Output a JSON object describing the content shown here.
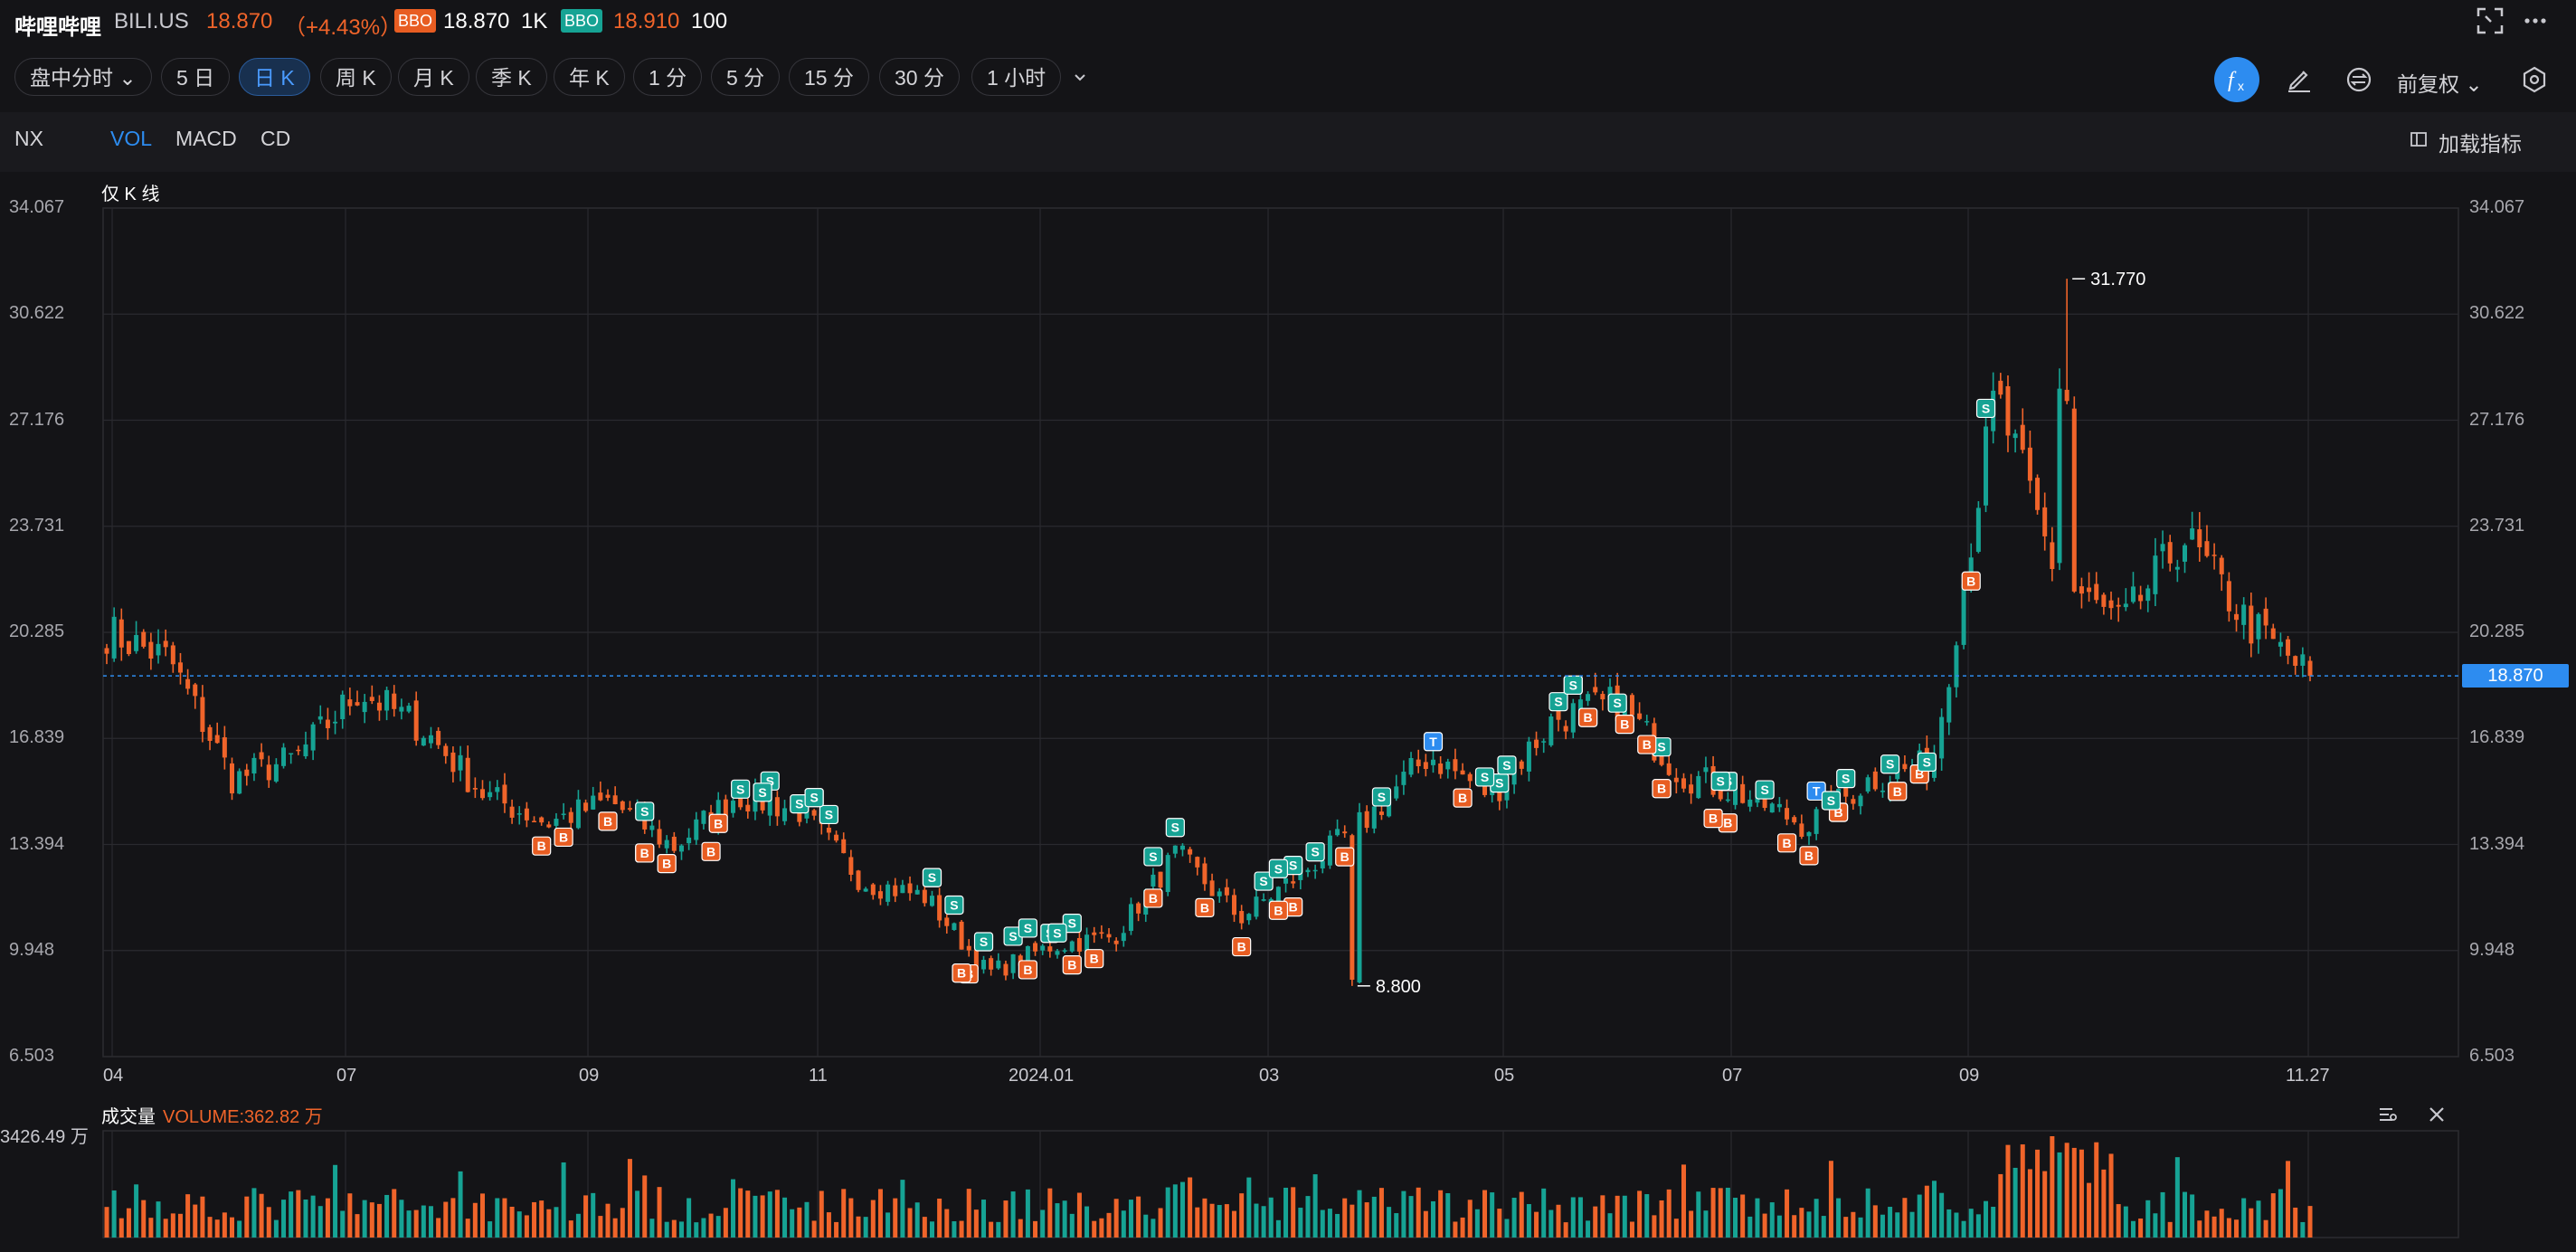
{
  "header": {
    "name": "哔哩哔哩",
    "ticker": "BILI.US",
    "price": "18.870",
    "change": "（+4.43%）",
    "bbo_bid_badge": "BBO",
    "bbo_bid_price": "18.870",
    "bbo_bid_qty": "1K",
    "bbo_ask_badge": "BBO",
    "bbo_ask_price": "18.910",
    "bbo_ask_qty": "100",
    "icons": [
      "fullscreen-icon",
      "more-icon"
    ]
  },
  "periods": {
    "items": [
      "盘中分时",
      "5 日",
      "日 K",
      "周 K",
      "月 K",
      "季 K",
      "年 K",
      "1 分",
      "5 分",
      "15 分",
      "30 分",
      "1 小时"
    ],
    "active": "日 K"
  },
  "right_toolbar": {
    "adjust": "前复权",
    "icons": [
      "formula-icon",
      "draw-icon",
      "compare-icon",
      "settings-icon"
    ]
  },
  "indicators": {
    "main": "NX",
    "items": [
      "VOL",
      "MACD",
      "CD"
    ],
    "active": "VOL",
    "load": "加载指标"
  },
  "chart": {
    "main_label": "仅 K 线",
    "price_ticks": [
      "34.067",
      "30.622",
      "27.176",
      "23.731",
      "20.285",
      "16.839",
      "13.394",
      "9.948",
      "6.503"
    ],
    "date_ticks": [
      "04",
      "07",
      "09",
      "11",
      "2024.01",
      "03",
      "05",
      "07",
      "09",
      "11.27"
    ],
    "current_price": "18.870",
    "high_label": "31.770",
    "low_label": "8.800",
    "colors": {
      "up": "#16a394",
      "down": "#f0642a",
      "current": "#2d8cf0"
    }
  },
  "volume": {
    "title": "成交量",
    "value": "VOLUME:362.82 万",
    "max": "3426.49 万"
  },
  "chart_data": {
    "type": "candlestick",
    "title": "仅 K 线",
    "ylim": [
      6.503,
      34.067
    ],
    "current_price": 18.87,
    "high": 31.77,
    "low": 8.8,
    "x_ticks": [
      "04",
      "07",
      "09",
      "11",
      "2024.01",
      "03",
      "05",
      "07",
      "09",
      "11.27"
    ],
    "close_path": [
      [
        "04",
        20.3
      ],
      [
        "05",
        19.4
      ],
      [
        "06",
        15.5
      ],
      [
        "07",
        16.2
      ],
      [
        "08",
        18.4
      ],
      [
        "08",
        17.2
      ],
      [
        "09",
        15.0
      ],
      [
        "10",
        14.1
      ],
      [
        "10",
        14.8
      ],
      [
        "11",
        13.3
      ],
      [
        "11",
        15.0
      ],
      [
        "12",
        14.5
      ],
      [
        "12",
        12.2
      ],
      [
        "2024.01",
        11.7
      ],
      [
        "02",
        9.2
      ],
      [
        "02",
        10.1
      ],
      [
        "03",
        10.4
      ],
      [
        "03",
        13.1
      ],
      [
        "04",
        11.0
      ],
      [
        "04",
        12.5
      ],
      [
        "05",
        14.2
      ],
      [
        "05",
        16.3
      ],
      [
        "06",
        15.0
      ],
      [
        "06",
        17.5
      ],
      [
        "07",
        18.0
      ],
      [
        "07",
        15.7
      ],
      [
        "08",
        15.0
      ],
      [
        "08",
        14.0
      ],
      [
        "09",
        15.5
      ],
      [
        "09",
        16.0
      ],
      [
        "10",
        28.0
      ],
      [
        "10",
        22.0
      ],
      [
        "10",
        20.5
      ],
      [
        "11",
        23.4
      ],
      [
        "11",
        20.6
      ],
      [
        "11.27",
        18.87
      ]
    ],
    "trade_markers": {
      "S": 40,
      "B": 36,
      "T": 2
    },
    "volume_max": "3426.49 万",
    "volume_latest": "362.82 万"
  }
}
